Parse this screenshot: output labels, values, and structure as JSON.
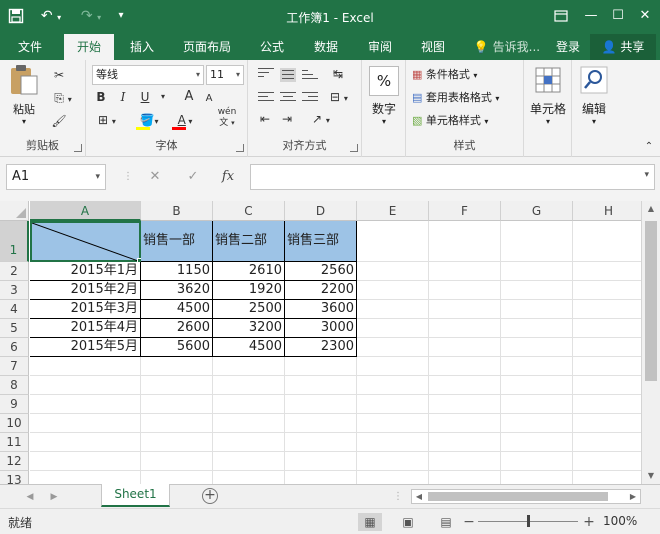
{
  "titlebar": {
    "title": "工作簿1 - Excel",
    "save_icon": "save-icon",
    "undo_icon": "undo-icon",
    "redo_icon": "redo-icon",
    "customize_icon": "customize-qat-icon",
    "ribbon_display_icon": "ribbon-display-icon",
    "minimize_icon": "minimize-icon",
    "maximize_icon": "maximize-icon",
    "close_icon": "close-icon"
  },
  "tabs": {
    "file": "文件",
    "home": "开始",
    "insert": "插入",
    "layout": "页面布局",
    "formulas": "公式",
    "data": "数据",
    "review": "审阅",
    "view": "视图",
    "tell_me": "告诉我...",
    "login": "登录",
    "share": "共享",
    "active": "开始"
  },
  "ribbon": {
    "clipboard": {
      "label": "剪贴板",
      "paste": "粘贴"
    },
    "font": {
      "label": "字体",
      "font_name": "等线",
      "font_size": "11",
      "bold": "B",
      "italic": "I",
      "underline": "U",
      "grow": "A",
      "shrink": "A",
      "phonetic": "wén"
    },
    "alignment": {
      "label": "对齐方式"
    },
    "number": {
      "label": "数字",
      "pct": "%"
    },
    "styles": {
      "label": "样式",
      "conditional": "条件格式",
      "table_format": "套用表格格式",
      "cell_styles": "单元格样式"
    },
    "cells": {
      "label": "单元格"
    },
    "editing": {
      "label": "编辑"
    },
    "colors": {
      "fill": "#ffff00",
      "font": "#ff0000"
    }
  },
  "formula_bar": {
    "name_box": "A1",
    "cancel": "✕",
    "enter": "✓",
    "fx": "fx",
    "value": ""
  },
  "sheet": {
    "columns": [
      "A",
      "B",
      "C",
      "D",
      "E",
      "F",
      "G",
      "H"
    ],
    "rows": [
      "1",
      "2",
      "3",
      "4",
      "5",
      "6",
      "7",
      "8",
      "9",
      "10",
      "11",
      "12",
      "13"
    ],
    "header_row": [
      "",
      "销售一部",
      "销售二部",
      "销售三部"
    ],
    "data": [
      [
        "2015年1月",
        "1150",
        "2610",
        "2560"
      ],
      [
        "2015年2月",
        "3620",
        "1920",
        "2200"
      ],
      [
        "2015年3月",
        "4500",
        "2500",
        "3600"
      ],
      [
        "2015年4月",
        "2600",
        "3200",
        "3000"
      ],
      [
        "2015年5月",
        "5600",
        "4500",
        "2300"
      ]
    ],
    "header_fill": "#9dc3e6"
  },
  "sheet_tabs": {
    "active": "Sheet1"
  },
  "status": {
    "ready": "就绪",
    "zoom": "100%"
  }
}
